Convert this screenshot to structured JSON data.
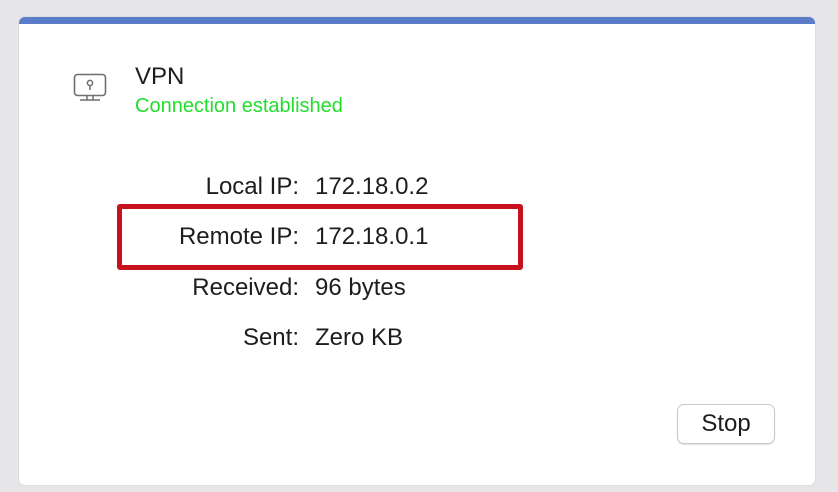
{
  "vpn": {
    "icon": "vpn-display-icon",
    "title": "VPN",
    "status": "Connection established",
    "status_color": "#22dd2c"
  },
  "info": {
    "local_ip": {
      "label": "Local IP:",
      "value": "172.18.0.2"
    },
    "remote_ip": {
      "label": "Remote IP:",
      "value": "172.18.0.1"
    },
    "received": {
      "label": "Received:",
      "value": "96 bytes"
    },
    "sent": {
      "label": "Sent:",
      "value": "Zero KB"
    }
  },
  "actions": {
    "stop_label": "Stop"
  },
  "colors": {
    "accent_bar": "#5a7cc9",
    "highlight": "#c8111f"
  }
}
